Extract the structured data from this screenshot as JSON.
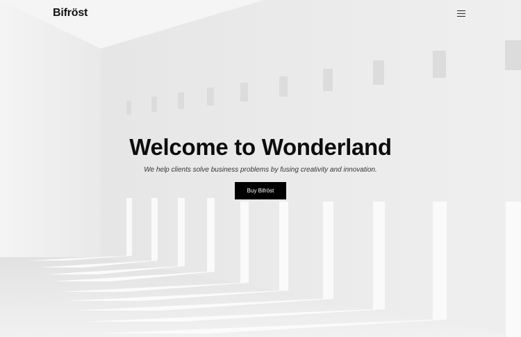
{
  "nav": {
    "logo": "Bifröst",
    "menu_icon": "hamburger-menu-icon"
  },
  "hero": {
    "title": "Welcome to Wonderland",
    "subtitle": "We help clients solve business problems by fusing creativity and innovation.",
    "cta_label": "Buy Bifröst"
  },
  "colors": {
    "background": "#ececec",
    "text": "#0d0d0d",
    "button_bg": "#000000",
    "button_text": "#ffffff"
  }
}
